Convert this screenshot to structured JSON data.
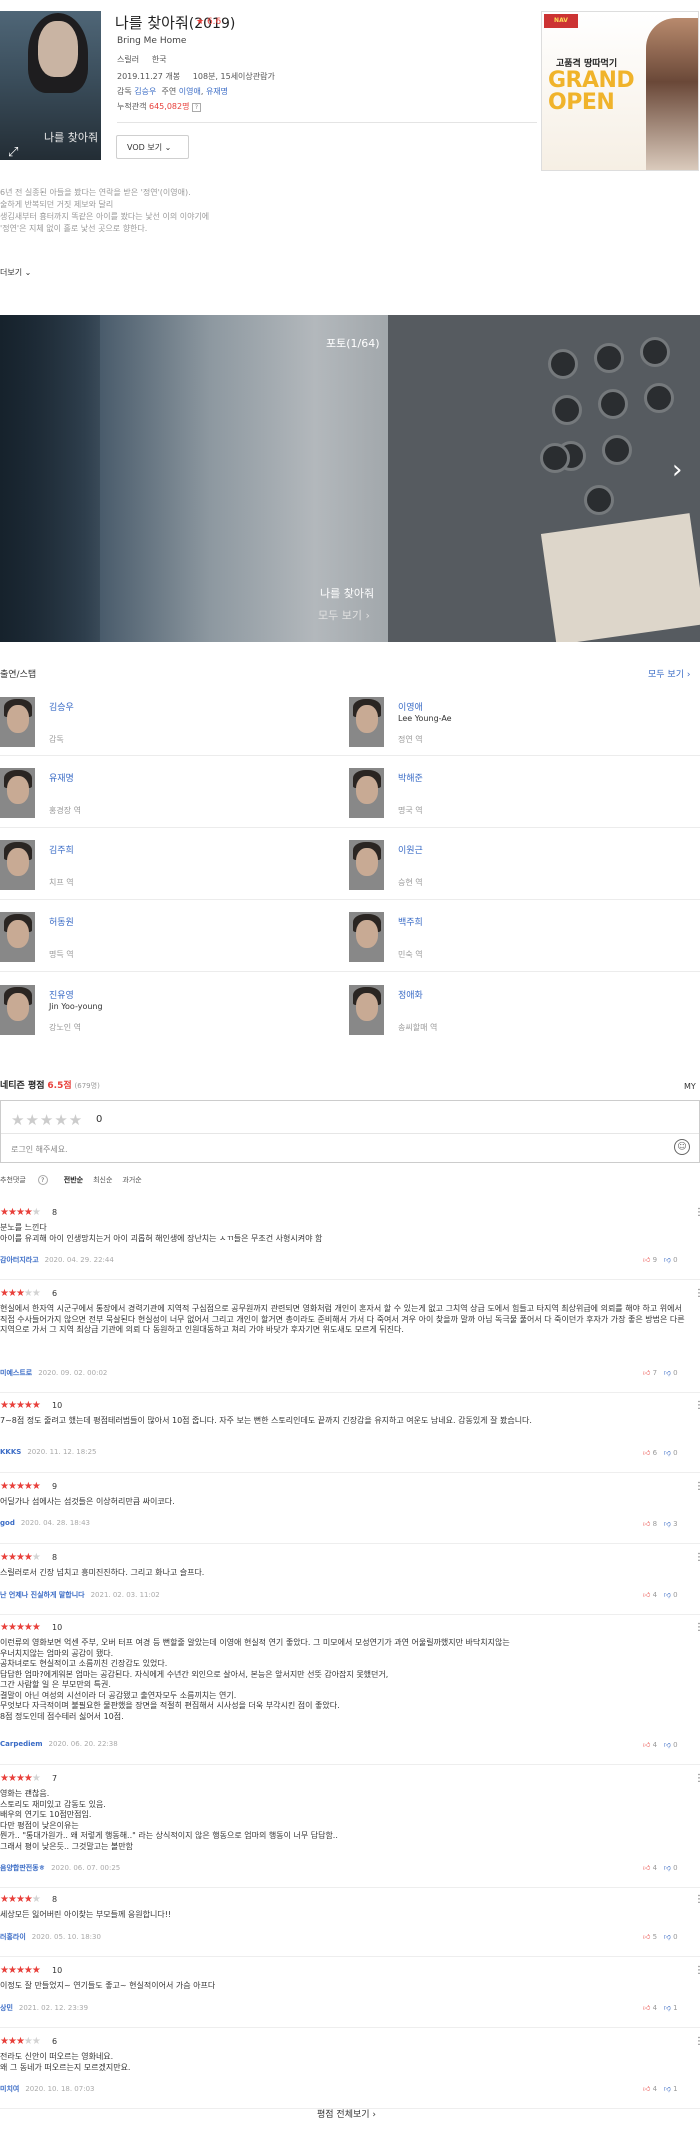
{
  "movie": {
    "title": "나를 찾아줘",
    "year": "(2019)",
    "rating": "6.6",
    "english_title": "Bring Me Home",
    "genre": "스릴러",
    "country": "한국",
    "release": "2019.11.27 개봉",
    "runtime": "108분, 15세이상관람가",
    "director_label": "감독",
    "director": "김승우",
    "cast_label": "주연",
    "lead1": "이영애",
    "lead2": "유재명",
    "audience_label": "누적관객",
    "audience": "645,082명",
    "poster_title": "나를 찾아줘",
    "vod_label": "VOD 보기"
  },
  "ad": {
    "logo": "고품격 땅따먹기",
    "line1": "고품격 땅따먹기",
    "grand": "GRAND",
    "open": "OPEN"
  },
  "synopsis": [
    "6년 전 실종된 아들을 봤다는 연락을 받은 '정연'(이영애).",
    "술하게 반복되던 거짓 제보와 달리",
    "생김새부터 흉터까지 똑같은 아이를 봤다는 낯선 이의 이야기에",
    "'정연'은 지체 없이 홀로 낯선 곳으로 향한다."
  ],
  "more_label": "더보기",
  "photo": {
    "counter": "포토(1/64)",
    "caption": "나를 찾아줘",
    "see_all": "모두 보기"
  },
  "cast_section": {
    "title": "출연/스탭",
    "more": "모두 보기",
    "people": [
      {
        "name": "김승우",
        "en": "",
        "role": "감독"
      },
      {
        "name": "이영애",
        "en": "Lee Young-Ae",
        "role": "정연 역"
      },
      {
        "name": "유재명",
        "en": "",
        "role": "홍경장 역"
      },
      {
        "name": "박해준",
        "en": "",
        "role": "명국 역"
      },
      {
        "name": "김주희",
        "en": "",
        "role": "치프 역"
      },
      {
        "name": "이원근",
        "en": "",
        "role": "승현 역"
      },
      {
        "name": "허동원",
        "en": "",
        "role": "명득 역"
      },
      {
        "name": "백주희",
        "en": "",
        "role": "민숙 역"
      },
      {
        "name": "진유영",
        "en": "Jin Yoo-young",
        "role": "강노인 역"
      },
      {
        "name": "정애화",
        "en": "",
        "role": "송씨할매 역"
      }
    ]
  },
  "reviews_section": {
    "title": "네티즌 평점",
    "score": "6.5점",
    "count": "(679명)",
    "my": "MY",
    "empty_stars": "★★★★★",
    "zero": "0",
    "placeholder": "로그인 해주세요.",
    "sort": [
      "추천댓글",
      "전반순",
      "최신순",
      "과거순"
    ],
    "all_label": "평점 전체보기"
  },
  "reviews": [
    {
      "stars": 4,
      "score": "8",
      "text": "분노를 느낀다\n아이를 유괴해 아이 인생망치는거 아이 괴롭혀 해인생에 장난치는 ㅅㄲ들은 무조건 사형시켜야 함",
      "author": "감아터지라고",
      "date": "2020. 04. 29. 22:44",
      "up": "9",
      "down": "0"
    },
    {
      "stars": 3,
      "score": "6",
      "text": "현실에서 한자역 시군구에서 통장에서 경력기관에 지역적 구심점으로 공무원까지 관련되면 영화처럼 개인이 혼자서 할 수 있는게 없고 그치역 상급 도에서 힘들고 타지역 최상위급에 의뢰를 해야 하고 위에서 직접 수사들어가지 않으면 전부 묵살된다 현실성이 너무 없어서 그리고 개인이 할거면 총이라도 준비해서 가서 다 죽여서 겨우 아이 찾을까 말까 아님 독극물 풀어서 다 죽이던가 후자가 가장 좋은 방법은 다른 지역으로 가서 그 지역 최상급 기관에 의뢰 다 동원하고 인원대동하고 쳐리 가야 바닷가 후자기면 위도새도 모르게 뒤진다.",
      "author": "미예스트로",
      "date": "2020. 09. 02. 00:02",
      "up": "7",
      "down": "0"
    },
    {
      "stars": 5,
      "score": "10",
      "text": "7~8점 정도 줄려고 했는데 평점테러범들이 많아서 10점 줍니다. 자주 보는 뻔한 스토리인데도 끝까지 긴장감을 유지하고 여운도 남네요.  감동있게 잘 봤습니다.",
      "author": "KKKS",
      "date": "2020. 11. 12. 18:25",
      "up": "6",
      "down": "0"
    },
    {
      "stars": 4.5,
      "score": "9",
      "text": "어딜가나 섬에사는 섬것들은 이상허리만큼 싸이코다.",
      "author": "god",
      "date": "2020. 04. 28. 18:43",
      "up": "8",
      "down": "3"
    },
    {
      "stars": 4,
      "score": "8",
      "text": "스릴러로서 긴장 넘치고 흥미진진하다. 그리고 화나고 슬프다.",
      "author": "난 언제나 진실하게 말합니다",
      "date": "2021. 02. 03. 11:02",
      "up": "4",
      "down": "0"
    },
    {
      "stars": 5,
      "score": "10",
      "text": "이런류의 영화보면 억센 주부, 오버 터프 여경 등 뻔할줄 알았는데 이영애  현실적 연기 좋았다. 그 미모에서 모성연기가 과연 어울릴까했지만 바닥치지않는\n우너치지않는 엄마의 공감이 됐다.\n공차녀로도 현실적이고 소름끼친 긴장감도 있었다.\n답답한 엄마?에게워본 엄마는 공감된다. 자식에게 수년간 외인으로 살아서, 본능은 앞서지만 선뜻 감아잡지 못했던거,\n그간 사람할 일 은 부모만의 특권.\n결말이 아닌 여성의 시선이라 더 공감됐고 출연자모두 소름끼치는 연기.\n무엇보다 자극적이며 불필요한 물판했을 장면을 적절히 편집해서 시사성을 더욱 부각시킨 점이 좋았다.\n8점 정도인데 점수테러 싫어서 10점.",
      "author": "Carpediem",
      "date": "2020. 06. 20. 22:38",
      "up": "4",
      "down": "0"
    },
    {
      "stars": 3.5,
      "score": "7",
      "text": "영화는 괜찮음.\n스토리도 재미있고 감동도 있음.\n배우의 연기도 10점만점임.\n다만 평점이 낮은이유는\n뭔가.. \"통대가원가.. 왜 저렇게 행동해..\" 라는 상식적이지 않은 행동으로 엄마의 행동이 너무 답답함..\n그래서 평이 낮은듯.. 그것말고는 볼만함",
      "author": "음양합판전동ㅎ",
      "date": "2020. 06. 07. 00:25",
      "up": "4",
      "down": "0"
    },
    {
      "stars": 4,
      "score": "8",
      "text": "세상모든 잃어버린 아이찾는 부모들께  응원합니다!!",
      "author": "러홍라이",
      "date": "2020. 05. 10. 18:30",
      "up": "5",
      "down": "0"
    },
    {
      "stars": 5,
      "score": "10",
      "text": "이정도 잘 만들었지~ 연기들도 좋고~ 현실적이어서  가슴 아프다",
      "author": "상민",
      "date": "2021. 02. 12. 23:39",
      "up": "4",
      "down": "1"
    },
    {
      "stars": 3,
      "score": "6",
      "text": "전라도 신안이 떠오르는 영화네요.\n왜 그 동네가 떠오르는지 모르겠지만요.",
      "author": "미치여",
      "date": "2020. 10. 18. 07:03",
      "up": "4",
      "down": "1"
    }
  ],
  "colors": {
    "accent": "#e8403b",
    "link": "#3b6cc6"
  }
}
